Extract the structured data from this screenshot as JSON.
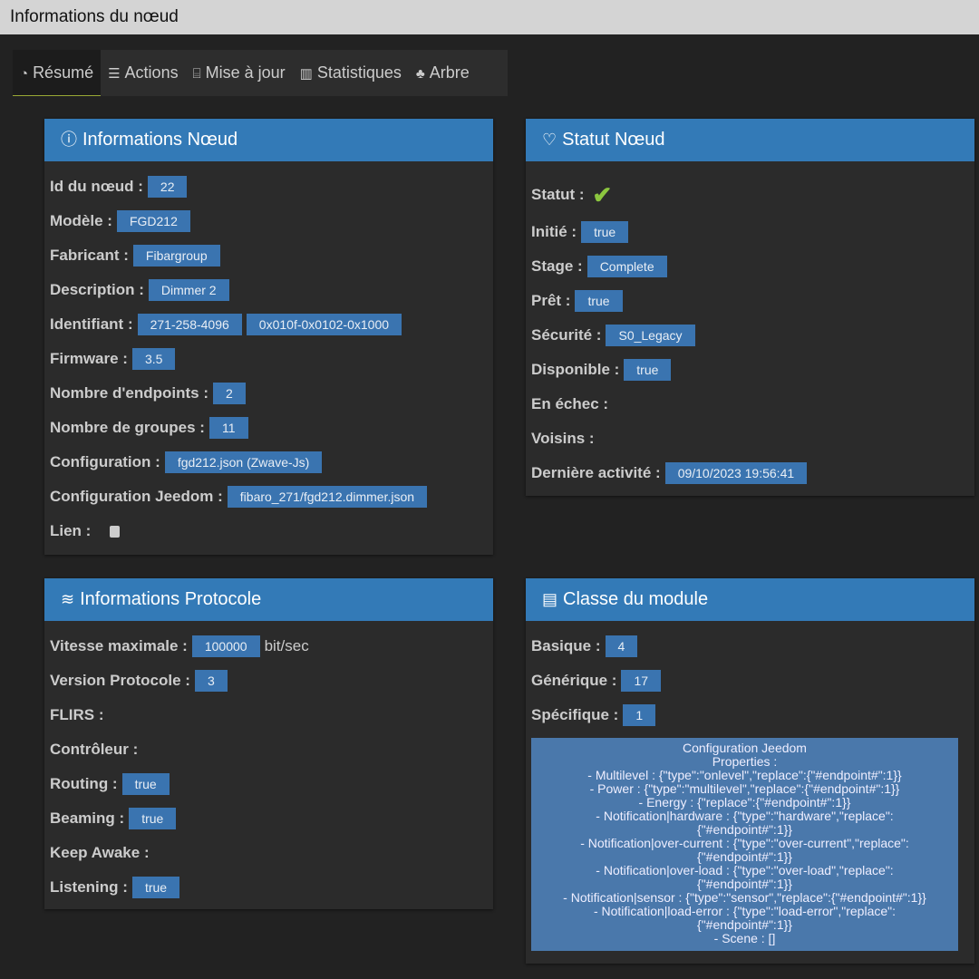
{
  "window": {
    "title": "Informations du nœud"
  },
  "tabs": [
    {
      "label": "Résumé",
      "icon": "dashboard-icon",
      "glyph": "◔",
      "active": true
    },
    {
      "label": "Actions",
      "icon": "sliders-icon",
      "glyph": "☰"
    },
    {
      "label": "Mise à jour",
      "icon": "router-icon",
      "glyph": "⌸"
    },
    {
      "label": "Statistiques",
      "icon": "bar-chart-icon",
      "glyph": "▥"
    },
    {
      "label": "Arbre",
      "icon": "tree-icon",
      "glyph": "♣"
    }
  ],
  "panels": {
    "node_info": {
      "title": "Informations Nœud",
      "icon": "info-icon",
      "glyph": "ⓘ",
      "rows": [
        {
          "label": "Id du nœud :",
          "values": [
            "22"
          ]
        },
        {
          "label": "Modèle :",
          "values": [
            "FGD212"
          ]
        },
        {
          "label": "Fabricant :",
          "values": [
            "Fibargroup"
          ]
        },
        {
          "label": "Description :",
          "values": [
            "Dimmer 2"
          ]
        },
        {
          "label": "Identifiant :",
          "values": [
            "271-258-4096",
            "0x010f-0x0102-0x1000"
          ]
        },
        {
          "label": "Firmware :",
          "values": [
            "3.5"
          ]
        },
        {
          "label": "Nombre d'endpoints :",
          "values": [
            "2"
          ]
        },
        {
          "label": "Nombre de groupes :",
          "values": [
            "11"
          ]
        },
        {
          "label": "Configuration :",
          "values": [
            "fgd212.json (Zwave-Js)"
          ]
        },
        {
          "label": "Configuration Jeedom :",
          "values": [
            "fibaro_271/fgd212.dimmer.json"
          ]
        },
        {
          "label": "Lien :",
          "values": [],
          "icon": "book-icon"
        }
      ]
    },
    "node_status": {
      "title": "Statut Nœud",
      "icon": "heartbeat-icon",
      "glyph": "♡",
      "rows": [
        {
          "label": "Statut :",
          "values": [],
          "icon": "check-icon"
        },
        {
          "label": "Initié :",
          "values": [
            "true"
          ]
        },
        {
          "label": "Stage :",
          "values": [
            "Complete"
          ]
        },
        {
          "label": "Prêt :",
          "values": [
            "true"
          ]
        },
        {
          "label": "Sécurité :",
          "values": [
            "S0_Legacy"
          ]
        },
        {
          "label": "Disponible :",
          "values": [
            "true"
          ]
        },
        {
          "label": "En échec :",
          "values": []
        },
        {
          "label": "Voisins :",
          "values": []
        },
        {
          "label": "Dernière activité :",
          "values": [
            "09/10/2023 19:56:41"
          ]
        }
      ]
    },
    "protocol": {
      "title": "Informations Protocole",
      "icon": "wifi-icon",
      "glyph": "≋",
      "rows": [
        {
          "label": "Vitesse maximale :",
          "values": [
            "100000"
          ],
          "unit": "bit/sec"
        },
        {
          "label": "Version Protocole :",
          "values": [
            "3"
          ]
        },
        {
          "label": "FLIRS :",
          "values": []
        },
        {
          "label": "Contrôleur :",
          "values": []
        },
        {
          "label": "Routing :",
          "values": [
            "true"
          ]
        },
        {
          "label": "Beaming :",
          "values": [
            "true"
          ]
        },
        {
          "label": "Keep Awake :",
          "values": []
        },
        {
          "label": "Listening :",
          "values": [
            "true"
          ]
        }
      ]
    },
    "module_class": {
      "title": "Classe du module",
      "icon": "clipboard-icon",
      "glyph": "▤",
      "rows": [
        {
          "label": "Basique :",
          "values": [
            "4"
          ]
        },
        {
          "label": "Générique :",
          "values": [
            "17"
          ]
        },
        {
          "label": "Spécifique :",
          "values": [
            "1"
          ]
        }
      ],
      "config": [
        "Configuration Jeedom",
        "Properties :",
        "- Multilevel : {\"type\":\"onlevel\",\"replace\":{\"#endpoint#\":1}}",
        "- Power : {\"type\":\"multilevel\",\"replace\":{\"#endpoint#\":1}}",
        "- Energy : {\"replace\":{\"#endpoint#\":1}}",
        "- Notification|hardware : {\"type\":\"hardware\",\"replace\": {\"#endpoint#\":1}}",
        "- Notification|over-current : {\"type\":\"over-current\",\"replace\": {\"#endpoint#\":1}}",
        "- Notification|over-load : {\"type\":\"over-load\",\"replace\": {\"#endpoint#\":1}}",
        "- Notification|sensor : {\"type\":\"sensor\",\"replace\":{\"#endpoint#\":1}}",
        "- Notification|load-error : {\"type\":\"load-error\",\"replace\": {\"#endpoint#\":1}}",
        "- Scene : []"
      ]
    }
  }
}
